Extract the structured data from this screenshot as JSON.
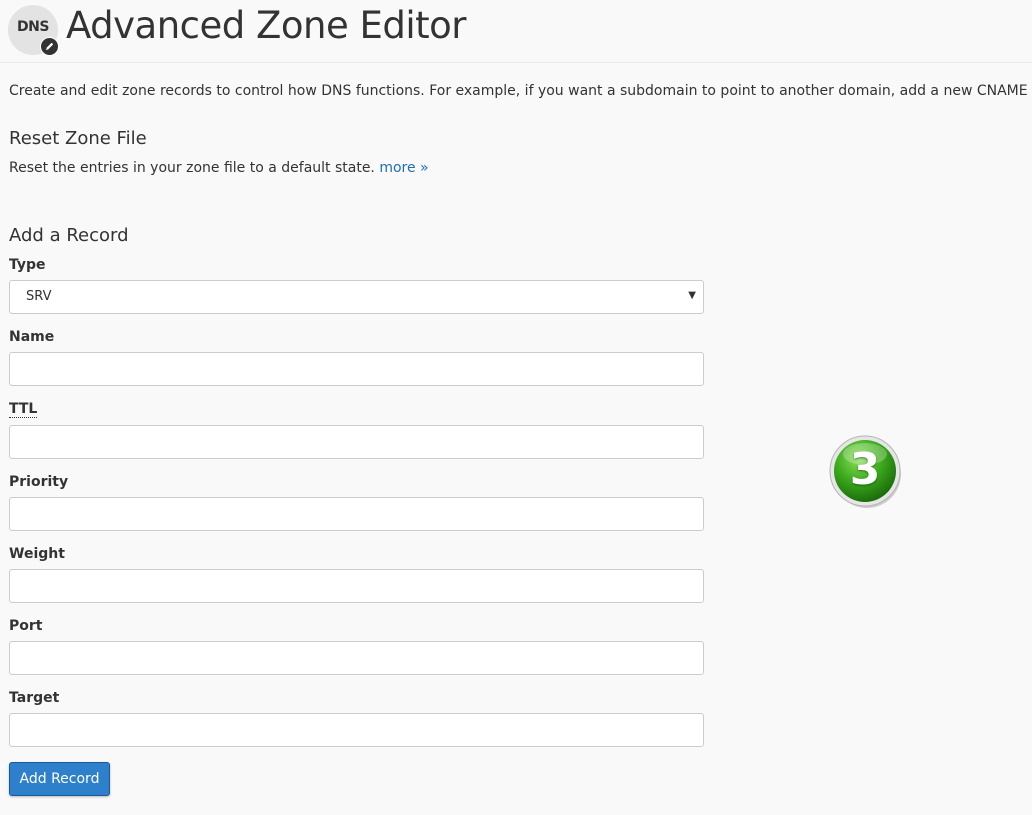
{
  "header": {
    "icon_text": "DNS",
    "title": "Advanced Zone Editor"
  },
  "intro": "Create and edit zone records to control how DNS functions. For example, if you want a subdomain to point to another domain, add a new CNAME record. For",
  "reset_zone": {
    "heading": "Reset Zone File",
    "description": "Reset the entries in your zone file to a default state.",
    "more_link": "more »"
  },
  "add_record": {
    "heading": "Add a Record",
    "type_label": "Type",
    "type_value": "SRV",
    "name_label": "Name",
    "name_value": "",
    "ttl_label": "TTL",
    "ttl_value": "",
    "priority_label": "Priority",
    "priority_value": "",
    "weight_label": "Weight",
    "weight_value": "",
    "port_label": "Port",
    "port_value": "",
    "target_label": "Target",
    "target_value": "",
    "submit_label": "Add Record"
  },
  "step_badge": "3",
  "icons": {
    "dns": "dns-icon",
    "pencil": "pencil-icon",
    "caret": "caret-down-icon"
  },
  "colors": {
    "background": "#f9f9f9",
    "link": "#1f6fb5",
    "primary_button": "#2f80cc",
    "badge_green": "#3aa81c"
  }
}
